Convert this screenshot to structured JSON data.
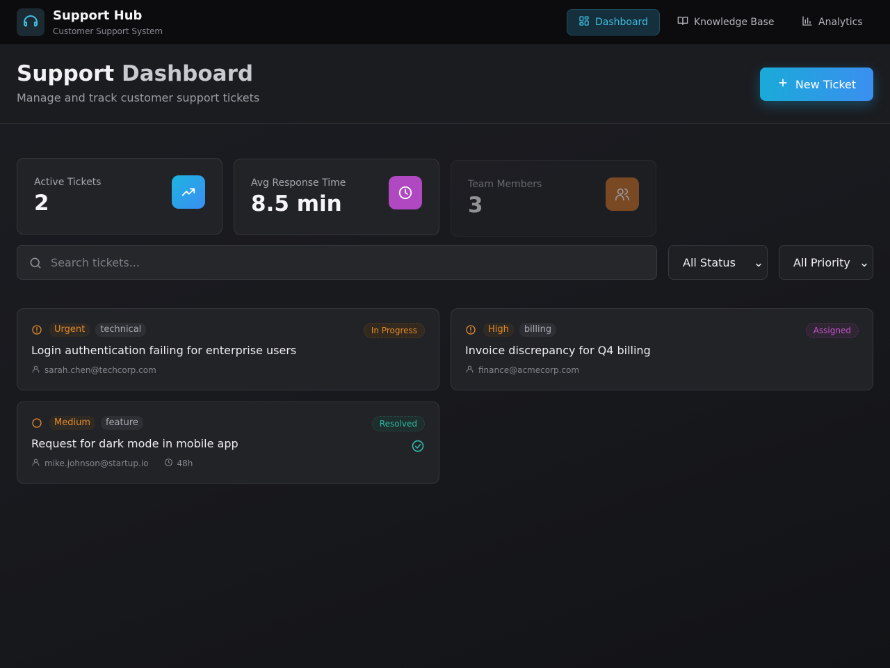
{
  "app": {
    "title": "Support Hub",
    "subtitle": "Customer Support System"
  },
  "nav": {
    "dashboard": "Dashboard",
    "knowledge_base": "Knowledge Base",
    "analytics": "Analytics",
    "active": "Dashboard"
  },
  "header": {
    "title_part1": "Support ",
    "title_part2": "Dashboard",
    "subtitle": "Manage and track customer support tickets",
    "new_ticket_label": "New Ticket"
  },
  "stats": [
    {
      "label": "Active Tickets",
      "value": "2",
      "icon": "trending-up-icon",
      "color": "#2aa6e6"
    },
    {
      "label": "Avg Response Time",
      "value": "8.5 min",
      "icon": "clock-icon",
      "color": "#b048c2"
    },
    {
      "label": "Team Members",
      "value": "3",
      "icon": "users-icon",
      "color": "#c8702a"
    }
  ],
  "search": {
    "placeholder": "Search tickets..."
  },
  "filters": {
    "status": "All Status",
    "priority": "All Priority"
  },
  "tickets": [
    {
      "priority": "Urgent",
      "category": "technical",
      "status": "In Progress",
      "title": "Login authentication failing for enterprise users",
      "email": "sarah.chen@techcorp.com"
    },
    {
      "priority": "High",
      "category": "billing",
      "status": "Assigned",
      "title": "Invoice discrepancy for Q4 billing",
      "email": "finance@acmecorp.com"
    },
    {
      "priority": "Medium",
      "category": "feature",
      "status": "Resolved",
      "title": "Request for dark mode in mobile app",
      "email": "mike.johnson@startup.io",
      "time": "48h"
    }
  ],
  "colors": {
    "accent": "#1aaad8",
    "priority": "#e58b28",
    "in_progress": "#e38c2a",
    "assigned": "#c057cc",
    "resolved": "#2fb7a4"
  }
}
